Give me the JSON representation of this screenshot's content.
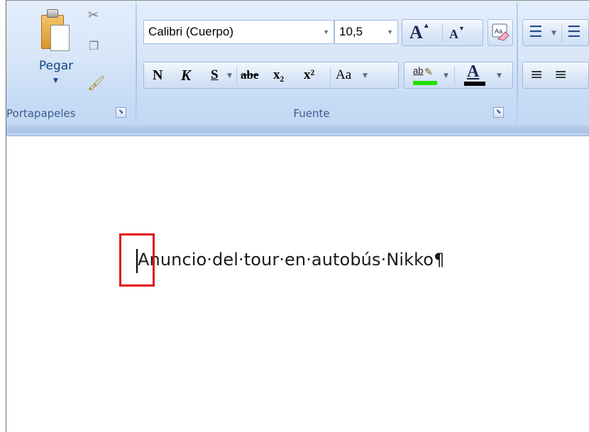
{
  "clipboard_group": {
    "paste_label": "Pegar",
    "group_label": "Portapapeles"
  },
  "font_group": {
    "font_name": "Calibri (Cuerpo)",
    "font_size": "10,5",
    "group_label": "Fuente",
    "bold_label": "N",
    "italic_label": "K",
    "underline_label": "S",
    "strike_label": "abe",
    "subscript_label": "x₂",
    "superscript_label": "x²",
    "change_case_label": "Aa",
    "grow_font_label": "A",
    "shrink_font_label": "A",
    "highlight_label": "ab",
    "font_color_label": "A"
  },
  "colors": {
    "highlight_color": "#22e000",
    "font_color": "#000000",
    "annotation_box": "#e11414",
    "ribbon_label": "#15428b"
  },
  "document": {
    "text": "Anuncio·del·tour·en·autobús·Nikko¶"
  }
}
